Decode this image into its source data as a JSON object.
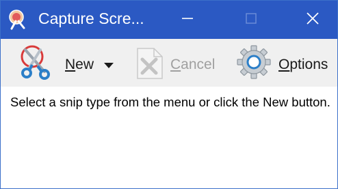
{
  "window": {
    "title": "Capture Scre..."
  },
  "toolbar": {
    "new_label_first": "N",
    "new_label_rest": "ew",
    "cancel_label_first": "C",
    "cancel_label_rest": "ancel",
    "options_label_first": "O",
    "options_label_rest": "ptions"
  },
  "content": {
    "message": "Select a snip type from the menu or click the New button."
  },
  "icons": {
    "app": "snipping-tool-icon",
    "new": "scissors-icon",
    "dropdown": "caret-down-icon",
    "cancel": "cancel-x-icon",
    "options": "gear-icon",
    "minimize": "minimize-icon",
    "maximize": "maximize-icon",
    "close": "close-icon"
  },
  "colors": {
    "titlebar": "#2b59c3",
    "toolbar": "#f0f0f0",
    "disabled_text": "#a0a0a0"
  }
}
